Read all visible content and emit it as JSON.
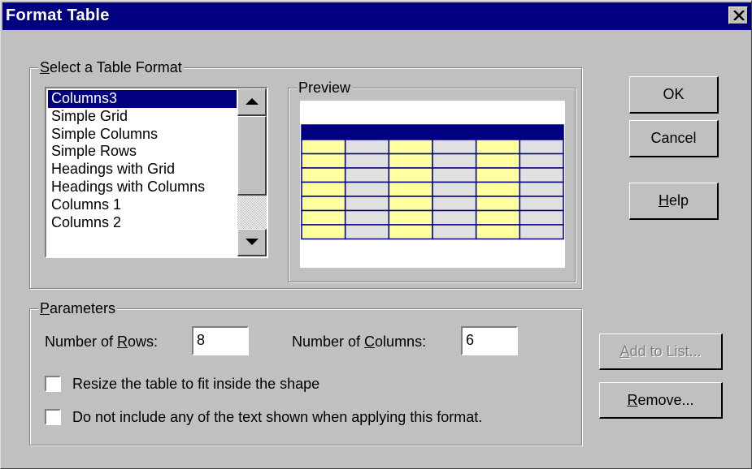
{
  "window": {
    "title": "Format Table"
  },
  "format_group": {
    "legend_mnemonic": "S",
    "legend_rest": "elect a Table Format",
    "items": [
      "Columns3",
      "Simple Grid",
      "Simple Columns",
      "Simple Rows",
      "Headings with Grid",
      "Headings with Columns",
      "Columns 1",
      "Columns 2"
    ],
    "selected": "Columns3"
  },
  "preview": {
    "legend": "Preview",
    "rows": 8,
    "columns": 6,
    "colors": {
      "header": "#000080",
      "highlight": "#ffffa0",
      "cell": "#e0e0e0",
      "grid": "#000080"
    }
  },
  "buttons": {
    "ok": "OK",
    "cancel": "Cancel",
    "help_mnemonic": "H",
    "help_rest": "elp",
    "add_mnemonic": "A",
    "add_rest": "dd to List...",
    "remove_mnemonic": "R",
    "remove_rest": "emove..."
  },
  "parameters": {
    "legend_mnemonic": "P",
    "legend_rest": "arameters",
    "rows_label_pre": "Number of ",
    "rows_label_mnemonic": "R",
    "rows_label_post": "ows:",
    "rows_value": "8",
    "cols_label_pre": "Number of ",
    "cols_label_mnemonic": "C",
    "cols_label_post": "olumns:",
    "cols_value": "6",
    "resize_label": "Resize the table to fit inside the shape",
    "resize_checked": false,
    "no_text_label": "Do not include any of the text shown when applying this format.",
    "no_text_checked": false
  }
}
